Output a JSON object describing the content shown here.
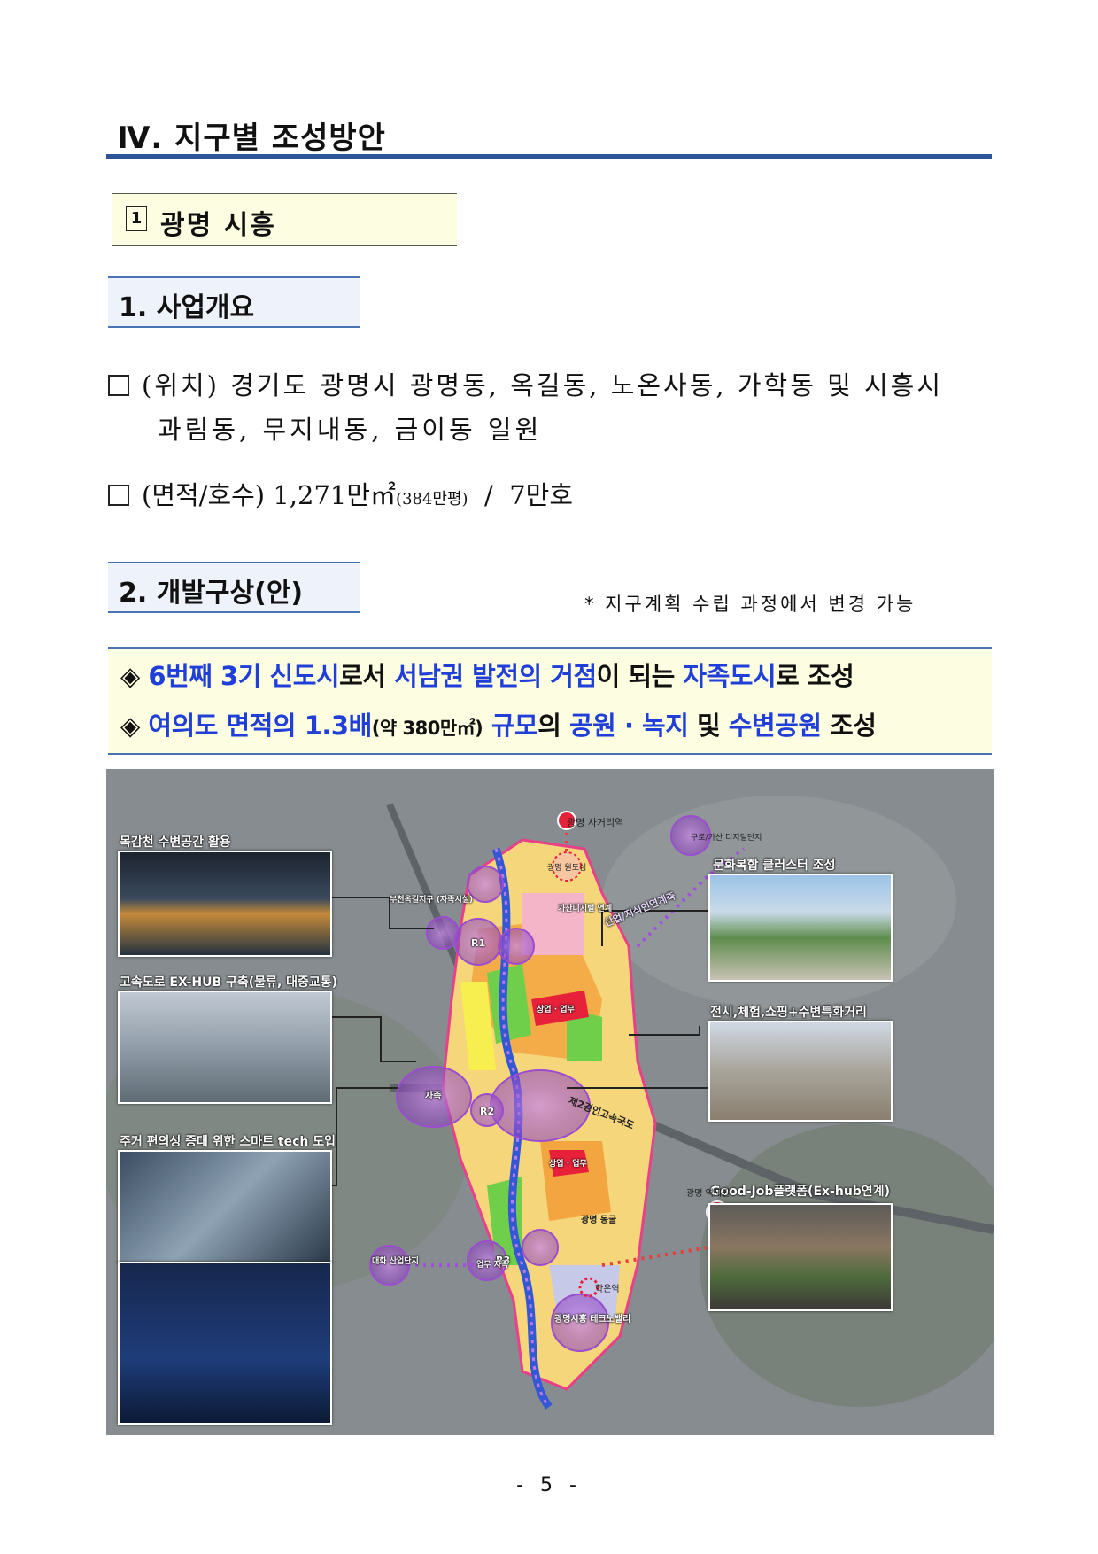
{
  "chapter": {
    "title": "Ⅳ. 지구별 조성방안"
  },
  "section": {
    "number": "1",
    "title": "광명 시흥"
  },
  "subsection1": {
    "title": "1. 사업개요"
  },
  "bullets": {
    "location_label": "(위치)",
    "location_line1": "경기도 광명시 광명동, 옥길동, 노온사동, 가학동 및 시흥시",
    "location_line2": "과림동, 무지내동, 금이동 일원",
    "area_label": "(면적/호수)",
    "area_value": "1,271만㎡",
    "area_paren": "(384만평)",
    "area_sep": "/",
    "households": "7만호"
  },
  "subsection2": {
    "title": "2. 개발구상(안)"
  },
  "note": "* 지구계획 수립 과정에서 변경 가능",
  "highlights": {
    "line1": {
      "mark": "◈",
      "p1": "6번째 3기 신도시",
      "p2": "로서 ",
      "p3": "서남권 발전의 거점",
      "p4": "이 되는 ",
      "p5": "자족도시",
      "p6": "로 조성"
    },
    "line2": {
      "mark": "◈",
      "p1": "여의도 면적의 1.3배",
      "p2": "(약 380만㎡)",
      "p3": " 규모",
      "p4": "의 ",
      "p5": "공원 · 녹지",
      "p6": " 및 ",
      "p7": "수변공원",
      "p8": " 조성"
    }
  },
  "map": {
    "captions": {
      "top_left": "목감천 수변공간 활용",
      "mid_left": "고속도로 EX-HUB 구축(물류, 대중교통)",
      "bottom_left": "주거 편의성 증대 위한 스마트 tech 도입",
      "top_right": "문화복합 클러스터 조성",
      "mid_right": "전시,체험,쇼핑+수변특화거리",
      "bottom_right": "Good-Job플랫폼(Ex-hub연계)"
    },
    "labels": {
      "station_top": "광명 사거리역",
      "gwangmyeong_center": "광명 원도심",
      "guro_gasan": "구로/가산 디지털단지",
      "bucheon": "부천옥길지구 (자족시설)",
      "gasan_link": "가산디지털 연계",
      "diag_link": "산업/지식인연계축",
      "highway": "제2경인고속국도",
      "station_right": "광명 역세권",
      "park": "광명 동굴",
      "maehwa": "매화 산업단지",
      "hwaseon": "학온역",
      "technovalley": "광명시흥 테크노밸리",
      "r1": "R1",
      "r2": "R2",
      "r3": "R3",
      "jajok": "자족",
      "commercial": "상업 · 업무",
      "business": "업무 자족"
    }
  },
  "page_number": "- 5 -"
}
